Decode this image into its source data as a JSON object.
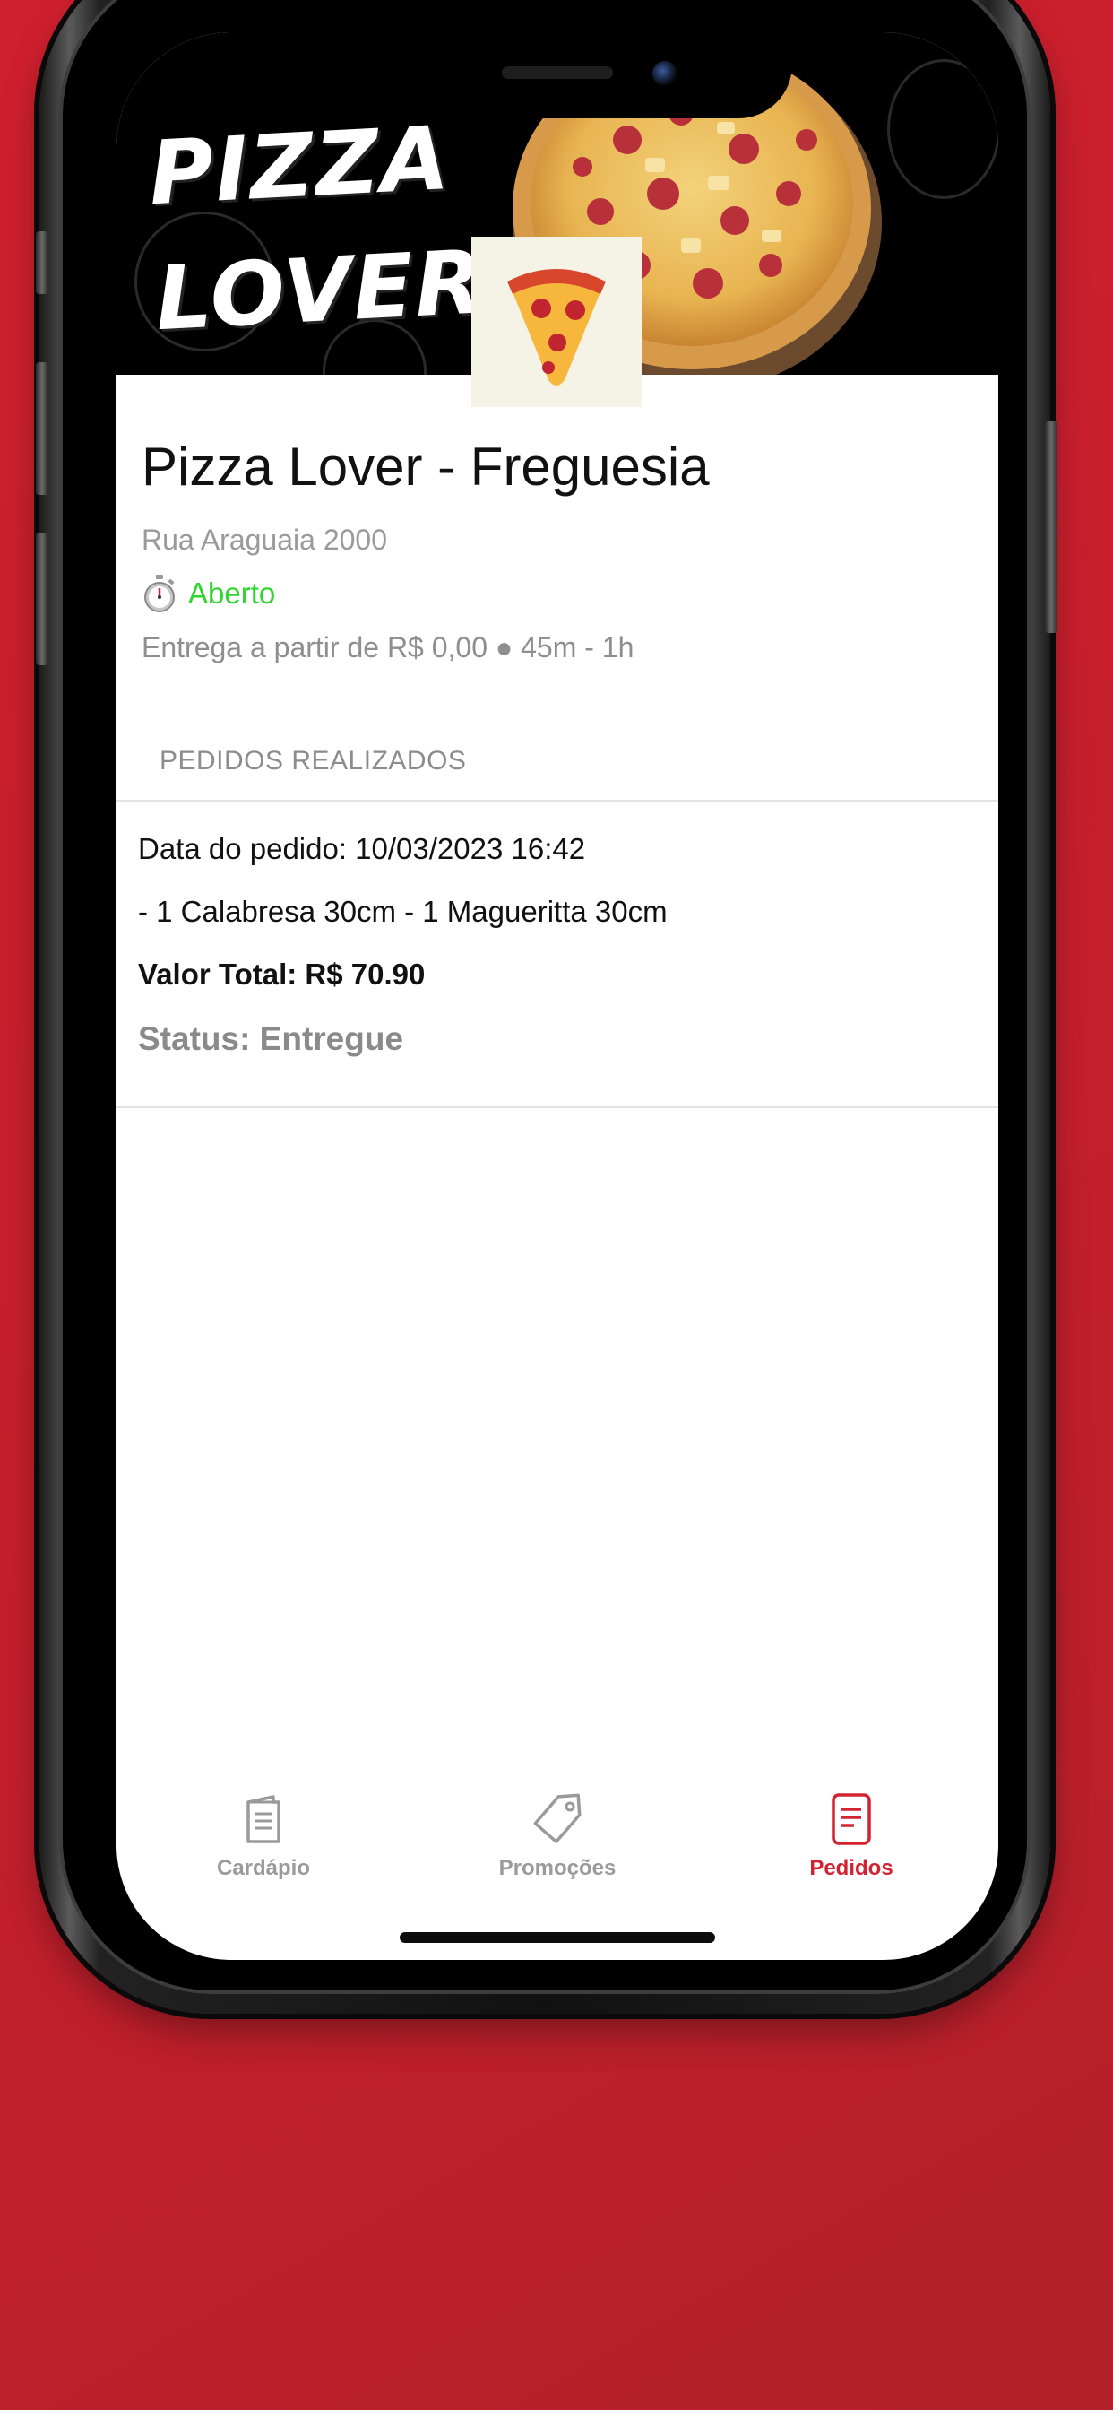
{
  "banner": {
    "brand_line_1": "PIZZA",
    "brand_line_2": "LOVER",
    "logo_icon": "pizza-slice-icon"
  },
  "store": {
    "name": "Pizza Lover - Freguesia",
    "address": "Rua Araguaia 2000",
    "status_icon": "stopwatch-icon",
    "status": "Aberto",
    "status_color": "#2fd52f",
    "delivery": "Entrega a partir de R$ 0,00 ● 45m - 1h"
  },
  "orders": {
    "section_title": "PEDIDOS REALIZADOS",
    "items": [
      {
        "date": "Data do pedido: 10/03/2023 16:42",
        "products": "- 1 Calabresa 30cm - 1 Magueritta 30cm",
        "total": "Valor Total: R$ 70.90",
        "status": "Status: Entregue"
      }
    ]
  },
  "tab_bar": {
    "accent_color": "#d42330",
    "inactive_color": "#9a9a9a",
    "tabs": [
      {
        "label": "Cardápio",
        "icon": "menu-book-icon",
        "active": false
      },
      {
        "label": "Promoções",
        "icon": "price-tag-icon",
        "active": false
      },
      {
        "label": "Pedidos",
        "icon": "receipt-icon",
        "active": true
      }
    ]
  },
  "background_color": "#c41f2c"
}
